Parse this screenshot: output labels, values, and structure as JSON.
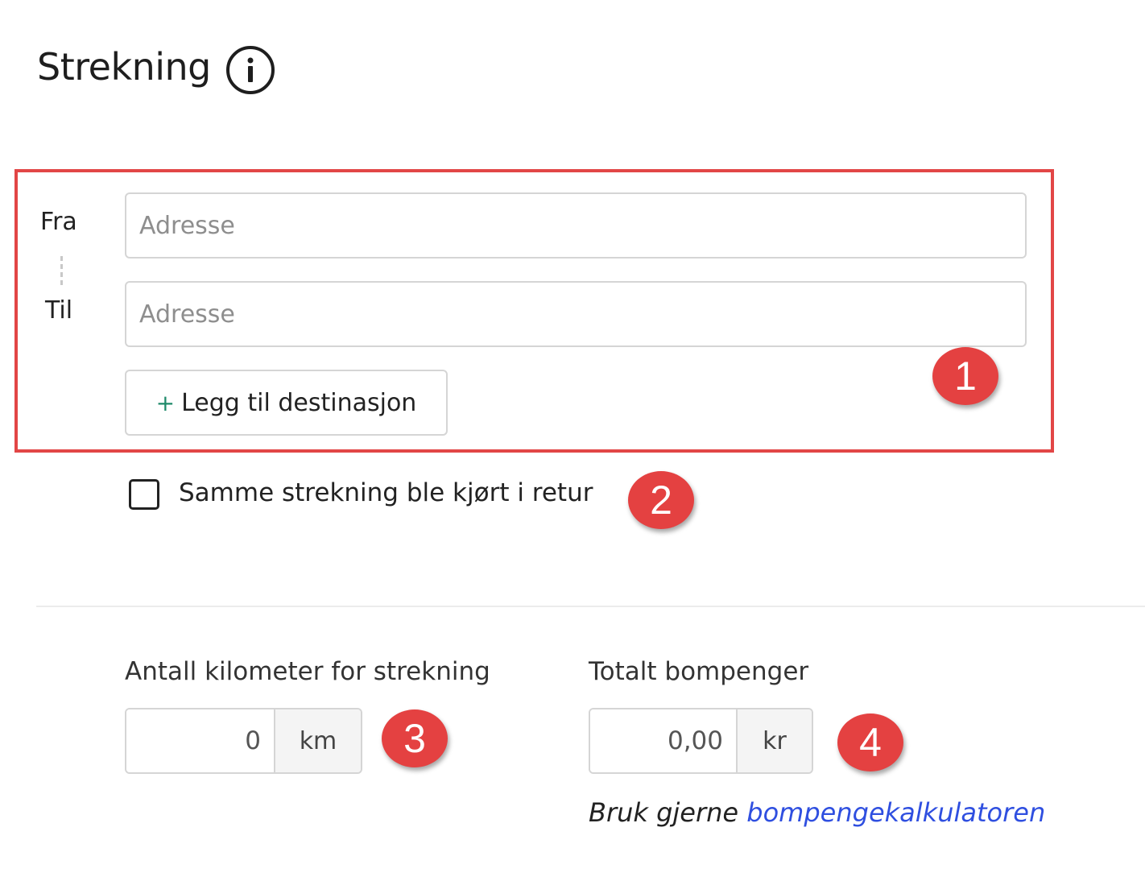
{
  "section": {
    "title": "Strekning",
    "info_icon": "info-circle-icon"
  },
  "route": {
    "from_label": "Fra",
    "to_label": "Til",
    "from_value": "",
    "from_placeholder": "Adresse",
    "to_value": "",
    "to_placeholder": "Adresse",
    "add_destination_plus": "+",
    "add_destination_label": "Legg til destinasjon",
    "return_checked": false,
    "return_label": "Samme strekning ble kjørt i retur"
  },
  "distance": {
    "label": "Antall kilometer for strekning",
    "value": "0",
    "unit": "km"
  },
  "toll": {
    "label": "Totalt bompenger",
    "value": "0,00",
    "unit": "kr",
    "hint_prefix": "Bruk gjerne",
    "hint_link": "bompengekalkulatoren"
  },
  "annotations": {
    "marker_1": "1",
    "marker_2": "2",
    "marker_3": "3",
    "marker_4": "4",
    "color": "#e44141"
  },
  "colors": {
    "accent_link": "#2f4fe0",
    "plus_green": "#1f8a6a",
    "highlight_border": "#e24646"
  }
}
